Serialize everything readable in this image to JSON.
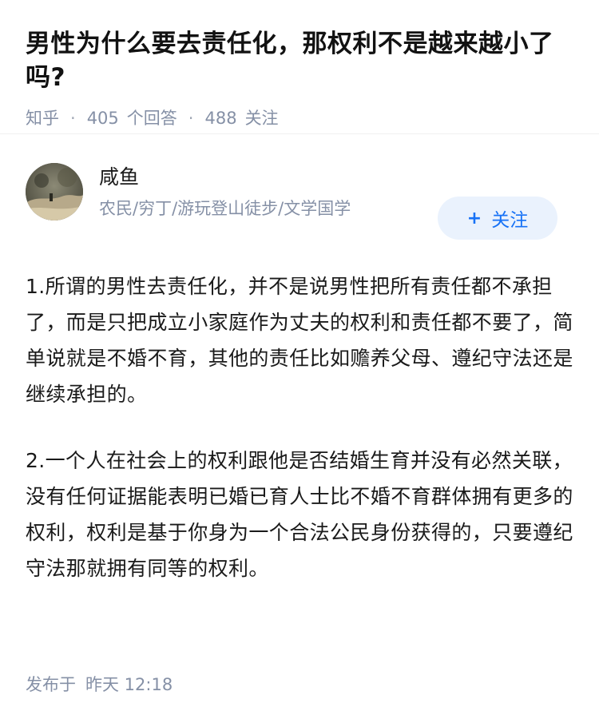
{
  "question": {
    "title": "男性为什么要去责任化，那权利不是越来越小了吗?",
    "source": "知乎",
    "separator": "·",
    "answer_count": "405",
    "answer_label": "个回答",
    "follower_count": "488",
    "follower_label": "关注"
  },
  "author": {
    "name": "咸鱼",
    "bio": "农民/穷丁/游玩登山徒步/文学国学",
    "avatar_icon": "avatar-photo-icon",
    "follow_label": "关注",
    "follow_icon": "plus-icon"
  },
  "answer": {
    "paragraphs": [
      "1.所谓的男性去责任化，并不是说男性把所有责任都不承担了，而是只把成立小家庭作为丈夫的权利和责任都不要了，简单说就是不婚不育，其他的责任比如赡养父母、遵纪守法还是继续承担的。",
      "2.一个人在社会上的权利跟他是否结婚生育并没有必然关联，没有任何证据能表明已婚已育人士比不婚不育群体拥有更多的权利，权利是基于你身为一个合法公民身份获得的，只要遵纪守法那就拥有同等的权利。"
    ],
    "published_label": "发布于",
    "published_time": "昨天 12:18"
  },
  "colors": {
    "meta_gray": "#8590a6",
    "follow_blue": "#1772f6",
    "follow_bg": "#eaf2fd"
  }
}
